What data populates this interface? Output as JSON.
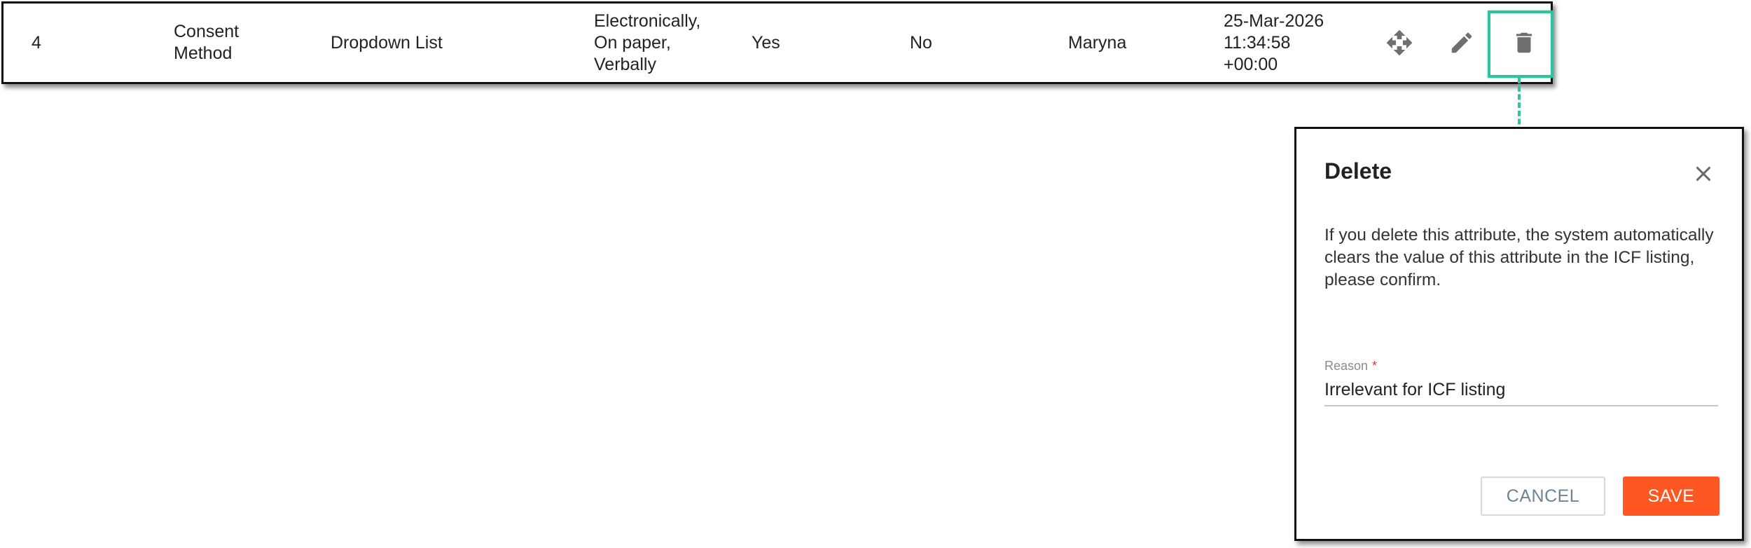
{
  "row": {
    "number": "4",
    "name": "Consent\nMethod",
    "type": "Dropdown List",
    "values": "Electronically,\nOn paper,\nVerbally",
    "required": "Yes",
    "multiple": "No",
    "user": "Maryna",
    "date": "25-Mar-2026\n11:34:58\n+00:00",
    "actions": {
      "move_icon": "move-icon",
      "edit_icon": "pencil-icon",
      "delete_icon": "trash-icon"
    }
  },
  "highlight": {
    "color": "#2cc4a0"
  },
  "dialog": {
    "title": "Delete",
    "close_icon": "close-icon",
    "message": "If you delete this attribute, the system automatically clears the value of this attribute in the ICF listing, please confirm.",
    "reason": {
      "label": "Reason",
      "required_mark": "*",
      "value": "Irrelevant for ICF listing"
    },
    "cancel_label": "CANCEL",
    "save_label": "SAVE",
    "save_color": "#ff5722"
  }
}
